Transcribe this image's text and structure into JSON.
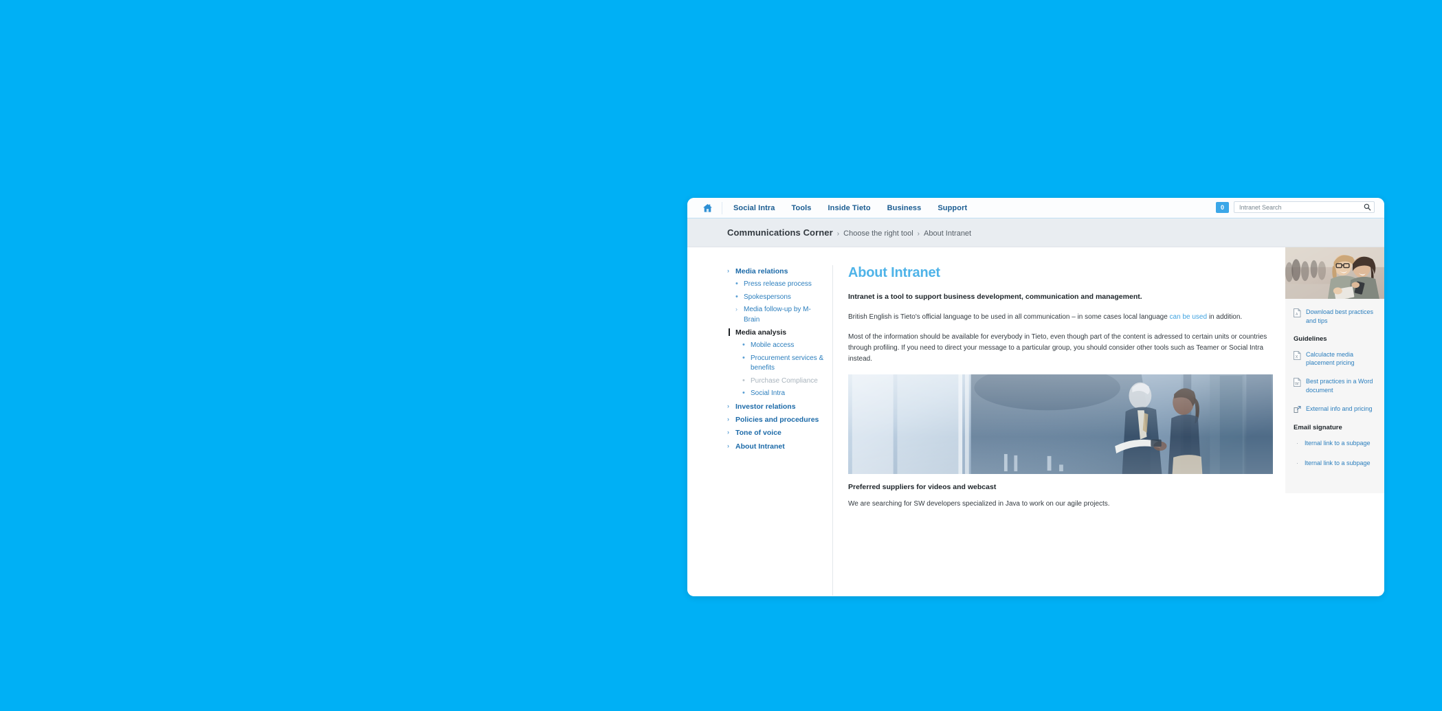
{
  "page_background_color": "#00b0f5",
  "topbar": {
    "home_icon": "home-icon",
    "items": [
      {
        "label": "Social Intra"
      },
      {
        "label": "Tools"
      },
      {
        "label": "Inside Tieto"
      },
      {
        "label": "Business"
      },
      {
        "label": "Support"
      }
    ],
    "badge_count": "0",
    "search": {
      "value": "",
      "placeholder": "Intranet Search",
      "icon": "search-icon"
    }
  },
  "breadcrumb": {
    "root": "Communications Corner",
    "separator": "›",
    "items": [
      {
        "label": "Choose the right tool"
      },
      {
        "label": "About Intranet"
      }
    ]
  },
  "sidebar": {
    "items": [
      {
        "label": "Media relations",
        "type": "top",
        "marker": "chevron-right-icon"
      },
      {
        "label": "Press release process",
        "type": "sub",
        "marker": "bullet"
      },
      {
        "label": "Spokespersons",
        "type": "sub",
        "marker": "bullet"
      },
      {
        "label": "Media follow-up by M-Brain",
        "type": "sub",
        "marker": "chevron-right-icon"
      },
      {
        "label": "Media analysis",
        "type": "active",
        "marker": "active-bar"
      },
      {
        "label": "Mobile access",
        "type": "deep",
        "marker": "bullet"
      },
      {
        "label": "Procurement services & benefits",
        "type": "deep",
        "marker": "bullet"
      },
      {
        "label": "Purchase Compliance",
        "type": "deep-muted",
        "marker": "bullet"
      },
      {
        "label": "Social Intra",
        "type": "deep",
        "marker": "bullet"
      },
      {
        "label": "Investor relations",
        "type": "top",
        "marker": "chevron-right-icon"
      },
      {
        "label": "Policies and procedures",
        "type": "top",
        "marker": "chevron-right-icon"
      },
      {
        "label": "Tone of voice",
        "type": "top",
        "marker": "chevron-right-icon"
      },
      {
        "label": "About Intranet",
        "type": "top",
        "marker": "chevron-right-icon"
      }
    ]
  },
  "main": {
    "title": "About Intranet",
    "lead": "Intranet is a tool to support business development, communication and management.",
    "para1_before": "British English is Tieto's official language to be used in all communication – in some cases local language ",
    "para1_link": "can be used",
    "para1_after": " in addition.",
    "para2": "Most of the information should be available for everybody in Tieto, even though part of the content is adressed to certain units or countries through profiling. If you need to direct your message to a particular group, you should consider other tools such as Teamer or Social Intra instead.",
    "hero_image_alt": "Two colleagues reviewing a document by a window",
    "sub_head": "Preferred suppliers for videos and webcast",
    "sub_para": "We are searching for SW developers specialized in Java to work on our agile projects."
  },
  "rightrail": {
    "photo_alt": "Two women looking at a tablet outdoors",
    "top_link": {
      "label": "Download best practices and tips",
      "icon": "pdf-document-icon"
    },
    "guidelines_heading": "Guidelines",
    "guideline_links": [
      {
        "label": "Calculacte media placement pricing",
        "icon": "excel-document-icon"
      },
      {
        "label": "Best practices in a Word document",
        "icon": "word-document-icon"
      },
      {
        "label": "External info and pricing",
        "icon": "external-link-icon"
      }
    ],
    "signature_heading": "Email signature",
    "signature_links": [
      {
        "label": "Iternal link to a subpage"
      },
      {
        "label": "Iternal link to a subpage"
      }
    ]
  }
}
